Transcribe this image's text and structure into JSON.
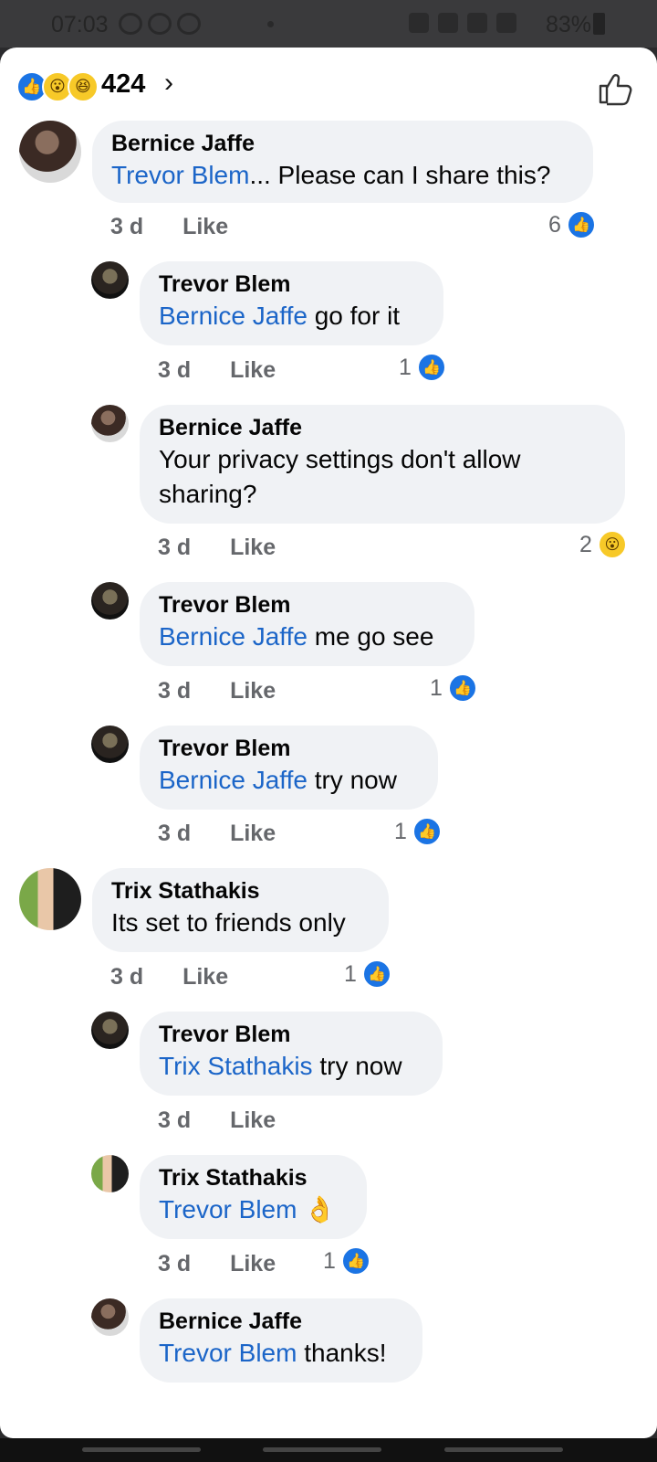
{
  "status_bar": {
    "time": "07:03",
    "battery": "83%"
  },
  "header": {
    "reaction_count": "424",
    "reactions": [
      "like",
      "wow",
      "haha"
    ]
  },
  "comments": [
    {
      "author": "Bernice Jaffe",
      "mention": "Trevor Blem",
      "text": "... Please can I share this?",
      "age": "3 d",
      "like_label": "Like",
      "reaction_count": "6",
      "reaction": "like"
    },
    {
      "author": "Trevor Blem",
      "mention": "Bernice Jaffe",
      "text": " go for it",
      "age": "3 d",
      "like_label": "Like",
      "reaction_count": "1",
      "reaction": "like"
    },
    {
      "author": "Bernice Jaffe",
      "mention": "",
      "text": "Your privacy settings don't allow sharing?",
      "age": "3 d",
      "like_label": "Like",
      "reaction_count": "2",
      "reaction": "wow"
    },
    {
      "author": "Trevor Blem",
      "mention": "Bernice Jaffe",
      "text": " me go see",
      "age": "3 d",
      "like_label": "Like",
      "reaction_count": "1",
      "reaction": "like"
    },
    {
      "author": "Trevor Blem",
      "mention": "Bernice Jaffe",
      "text": " try now",
      "age": "3 d",
      "like_label": "Like",
      "reaction_count": "1",
      "reaction": "like"
    },
    {
      "author": "Trix Stathakis",
      "mention": "",
      "text": "Its set to friends only",
      "age": "3 d",
      "like_label": "Like",
      "reaction_count": "1",
      "reaction": "like"
    },
    {
      "author": "Trevor Blem",
      "mention": "Trix Stathakis",
      "text": " try now",
      "age": "3 d",
      "like_label": "Like",
      "reaction_count": "",
      "reaction": ""
    },
    {
      "author": "Trix Stathakis",
      "mention": "Trevor Blem",
      "text": " 👌",
      "age": "3 d",
      "like_label": "Like",
      "reaction_count": "1",
      "reaction": "like"
    },
    {
      "author": "Bernice Jaffe",
      "mention": "Trevor Blem",
      "text": " thanks!",
      "age": "",
      "like_label": "",
      "reaction_count": "",
      "reaction": ""
    }
  ],
  "colors": {
    "accent": "#1b74e4",
    "mention": "#1b65c8",
    "bubble": "#f0f2f5",
    "wow": "#f7c928"
  }
}
